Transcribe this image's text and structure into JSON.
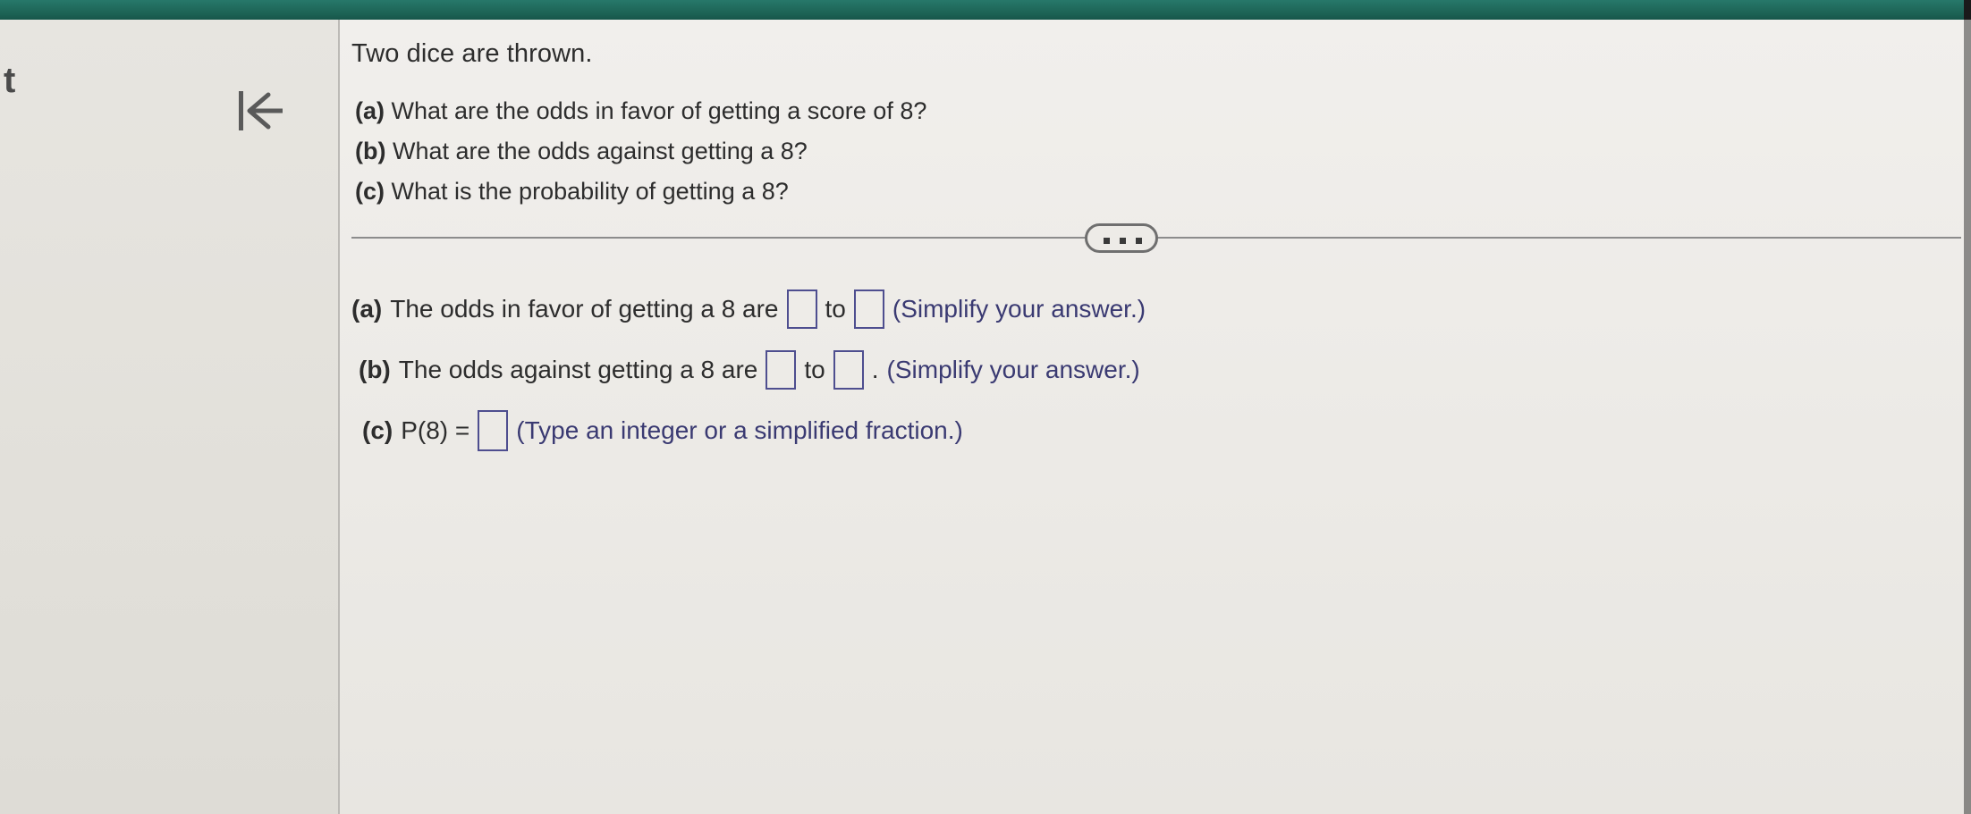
{
  "window": {
    "topbar_color": "#1f6b5e",
    "page_background": "#efedea"
  },
  "left_rail": {
    "clipped_text": "t",
    "back_icon_name": "skip-to-start-icon"
  },
  "question": {
    "stem": "Two dice are thrown.",
    "parts": [
      {
        "label": "(a)",
        "text": " What are the odds in favor of getting a score of 8?"
      },
      {
        "label": "(b)",
        "text": " What are the odds against getting a 8?"
      },
      {
        "label": "(c)",
        "text": " What is the probability of getting a 8?"
      }
    ]
  },
  "divider": {
    "more_button_label": "•••"
  },
  "answers": {
    "a": {
      "label": "(a)",
      "lead": "The odds in favor of getting a 8 are",
      "box1_value": "",
      "joiner": "to",
      "box2_value": "",
      "trailing": "",
      "hint": "(Simplify your answer.)"
    },
    "b": {
      "label": "(b)",
      "lead": "The odds against getting a 8 are",
      "box1_value": "",
      "joiner": "to",
      "box2_value": "",
      "trailing": ".",
      "hint": "(Simplify your answer.)"
    },
    "c": {
      "label": "(c)",
      "lead": "P(8) =",
      "box1_value": "",
      "hint": "(Type an integer or a simplified fraction.)"
    }
  },
  "colors": {
    "answer_box_border": "#4e4e8f",
    "hint_text": "#3a3a72",
    "body_text": "#2d2d2d",
    "divider": "#8c8c8c"
  }
}
